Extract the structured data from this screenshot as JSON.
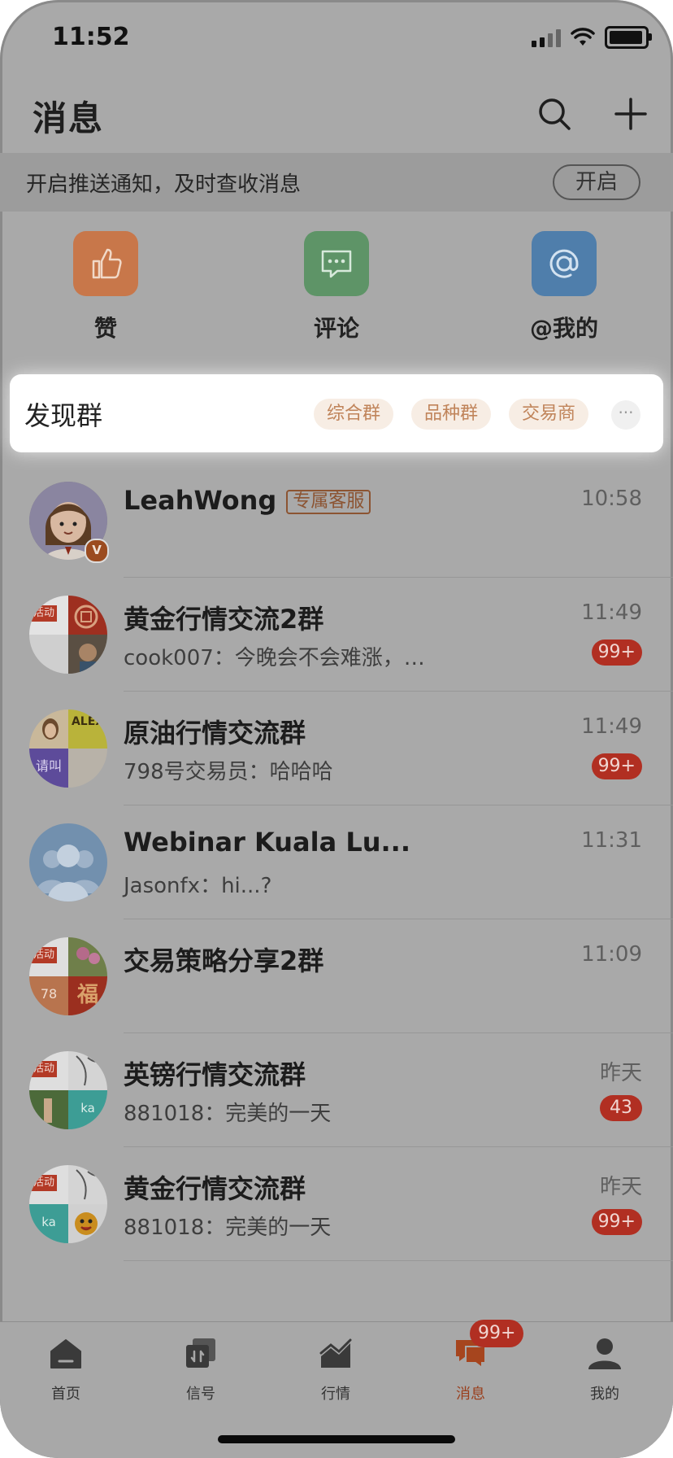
{
  "status_bar": {
    "time": "11:52"
  },
  "header": {
    "title": "消息"
  },
  "push_bar": {
    "text": "开启推送通知，及时查收消息",
    "button": "开启"
  },
  "quick_actions": [
    {
      "label": "赞",
      "icon": "thumbs-up-icon",
      "color": "#c8774a"
    },
    {
      "label": "评论",
      "icon": "chat-bubble-icon",
      "color": "#5e9467"
    },
    {
      "label": "@我的",
      "icon": "at-sign-icon",
      "color": "#4f7eab"
    }
  ],
  "discover": {
    "title": "发现群",
    "chips": [
      "综合群",
      "品种群",
      "交易商"
    ],
    "more": "···"
  },
  "conversations": [
    {
      "name": "LeahWong",
      "tag": "专属客服",
      "time": "10:58",
      "message": "",
      "badge": ""
    },
    {
      "name": "黄金行情交流2群",
      "time": "11:49",
      "message": "cook007：今晚会不会难涨，…",
      "badge": "99+"
    },
    {
      "name": "原油行情交流群",
      "time": "11:49",
      "message": "798号交易员：哈哈哈",
      "badge": "99+"
    },
    {
      "name": "Webinar Kuala Lu...",
      "time": "11:31",
      "message": "Jasonfx：hi...?",
      "badge": ""
    },
    {
      "name": "交易策略分享2群",
      "time": "11:09",
      "message": "",
      "badge": ""
    },
    {
      "name": "英镑行情交流群",
      "time": "昨天",
      "message": "881018：完美的一天",
      "badge": "43"
    },
    {
      "name": "黄金行情交流群",
      "time": "昨天",
      "message": "881018：完美的一天",
      "badge": "99+"
    }
  ],
  "avatar_text": {
    "activity": "活动",
    "call": "请叫",
    "alex": "ALEX",
    "num78": "78",
    "ka": "ka",
    "fu": "福",
    "v": "V"
  },
  "tabbar": {
    "items": [
      {
        "label": "首页",
        "icon": "home-icon"
      },
      {
        "label": "信号",
        "icon": "signal-icon"
      },
      {
        "label": "行情",
        "icon": "chart-icon"
      },
      {
        "label": "消息",
        "icon": "messages-icon"
      },
      {
        "label": "我的",
        "icon": "profile-icon"
      }
    ],
    "active": "消息",
    "message_badge": "99+"
  },
  "colors": {
    "accent": "#c0845a",
    "badge": "#b12f22",
    "overlay": "#a9a9a9"
  }
}
